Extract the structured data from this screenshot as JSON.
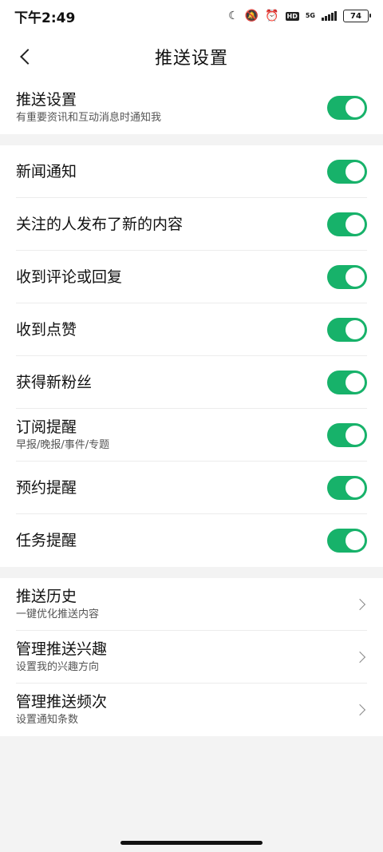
{
  "status": {
    "time": "下午2:49",
    "network": "5G",
    "battery": "74"
  },
  "nav": {
    "title": "推送设置"
  },
  "push_main": {
    "label": "推送设置",
    "sub": "有重要资讯和互动消息时通知我",
    "on": true
  },
  "notifications": [
    {
      "label": "新闻通知",
      "sub": "",
      "on": true
    },
    {
      "label": "关注的人发布了新的内容",
      "sub": "",
      "on": true
    },
    {
      "label": "收到评论或回复",
      "sub": "",
      "on": true
    },
    {
      "label": "收到点赞",
      "sub": "",
      "on": true
    },
    {
      "label": "获得新粉丝",
      "sub": "",
      "on": true
    },
    {
      "label": "订阅提醒",
      "sub": "早报/晚报/事件/专题",
      "on": true
    },
    {
      "label": "预约提醒",
      "sub": "",
      "on": true
    },
    {
      "label": "任务提醒",
      "sub": "",
      "on": true
    }
  ],
  "links": [
    {
      "label": "推送历史",
      "sub": "一键优化推送内容"
    },
    {
      "label": "管理推送兴趣",
      "sub": "设置我的兴趣方向"
    },
    {
      "label": "管理推送频次",
      "sub": "设置通知条数"
    }
  ],
  "colors": {
    "toggle_on": "#17b26a",
    "background": "#f3f3f3"
  }
}
